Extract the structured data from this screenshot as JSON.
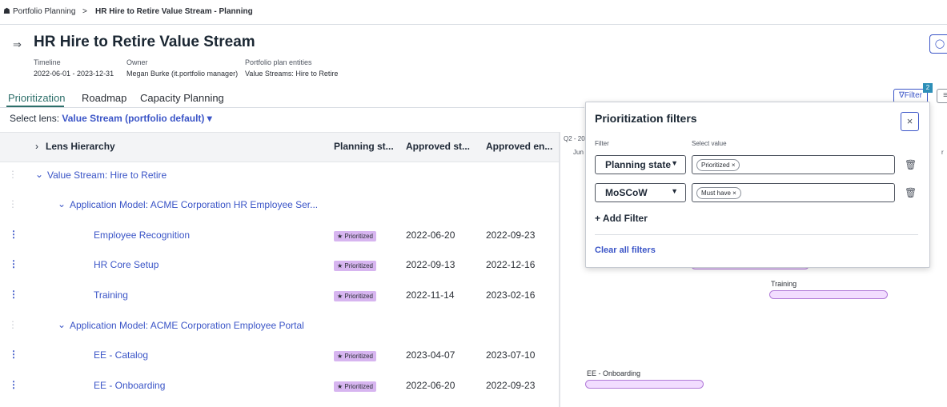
{
  "breadcrumb": {
    "root": "Portfolio Planning",
    "separator": ">",
    "current": "HR Hire to Retire Value Stream - Planning"
  },
  "header": {
    "title": "HR Hire to Retire Value Stream",
    "meta": [
      {
        "label": "Timeline",
        "value": "2022-06-01 - 2023-12-31"
      },
      {
        "label": "Owner",
        "value": "Megan Burke (it.portfolio manager)"
      },
      {
        "label": "Portfolio plan entities",
        "value": "Value Streams: Hire to Retire"
      }
    ]
  },
  "tabs": [
    "Prioritization",
    "Roadmap",
    "Capacity Planning"
  ],
  "lens": {
    "prefix": "Select lens:",
    "value": "Value Stream (portfolio default) ▾"
  },
  "columns": [
    "Lens Hierarchy",
    "Planning st...",
    "Approved st...",
    "Approved en..."
  ],
  "rows": [
    {
      "name": "Value Stream: Hire to Retire",
      "type": "group"
    },
    {
      "name": "Application Model: ACME Corporation HR Employee Ser...",
      "type": "subgroup"
    },
    {
      "name": "Employee Recognition",
      "state": "Prioritized",
      "start": "2022-06-20",
      "end": "2022-09-23"
    },
    {
      "name": "HR Core Setup",
      "state": "Prioritized",
      "start": "2022-09-13",
      "end": "2022-12-16"
    },
    {
      "name": "Training",
      "state": "Prioritized",
      "start": "2022-11-14",
      "end": "2023-02-16"
    },
    {
      "name": "Application Model: ACME Corporation Employee Portal",
      "type": "subgroup"
    },
    {
      "name": "EE - Catalog",
      "state": "Prioritized",
      "start": "2023-04-07",
      "end": "2023-07-10"
    },
    {
      "name": "EE - Onboarding",
      "state": "Prioritized",
      "start": "2022-06-20",
      "end": "2022-09-23"
    }
  ],
  "gantt": {
    "quarter_label": "Q2 - 20",
    "month_label": "Jun",
    "edge_label": "r",
    "bar_labels": {
      "training": "Training",
      "onboarding": "EE - Onboarding"
    }
  },
  "toolbar": {
    "filter_label": "Filter",
    "filter_count": "2"
  },
  "filters_panel": {
    "title": "Prioritization filters",
    "filter_col_label": "Filter",
    "value_col_label": "Select value",
    "filters": [
      {
        "field": "Planning state",
        "value": "Prioritized"
      },
      {
        "field": "MoSCoW",
        "value": "Must have"
      }
    ],
    "add_label": "Add Filter",
    "clear_label": "Clear all filters"
  },
  "colors": {
    "link": "#3b55c7",
    "accent": "#2d6f6a",
    "badge": "#d7b5f0",
    "bar": "#b17ad8"
  }
}
